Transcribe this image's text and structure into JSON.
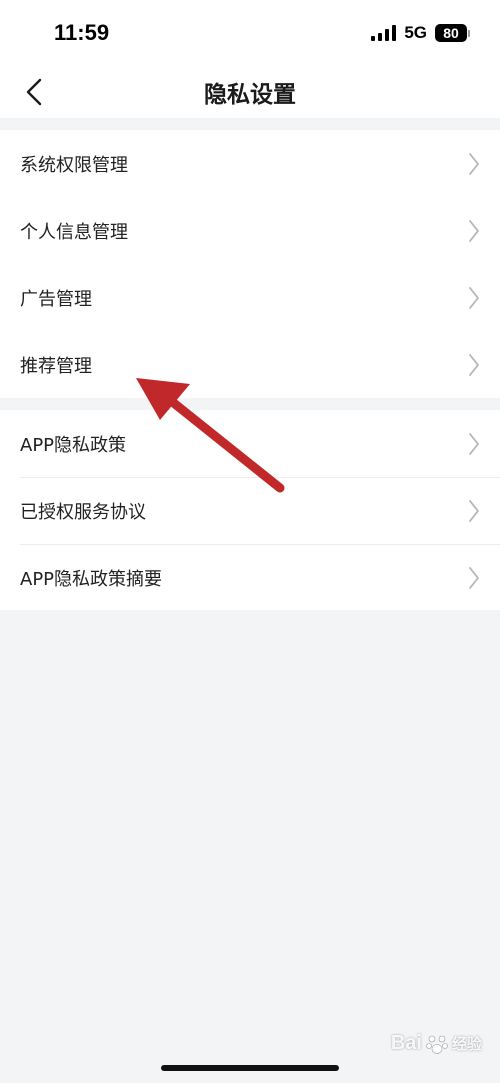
{
  "status_bar": {
    "time": "11:59",
    "network": "5G",
    "battery": "80",
    "icons": [
      "signal-icon",
      "battery-icon"
    ]
  },
  "header": {
    "title": "隐私设置",
    "back_icon": "chevron-left-icon"
  },
  "sections": [
    {
      "items": [
        {
          "label": "系统权限管理"
        },
        {
          "label": "个人信息管理"
        },
        {
          "label": "广告管理"
        },
        {
          "label": "推荐管理"
        }
      ]
    },
    {
      "items": [
        {
          "label": "APP隐私政策"
        },
        {
          "label": "已授权服务协议"
        },
        {
          "label": "APP隐私政策摘要"
        }
      ]
    }
  ],
  "annotation": {
    "arrow_color": "#c0282a",
    "target": "推荐管理"
  },
  "watermark": {
    "brand": "Bai",
    "sub": "经验"
  },
  "colors": {
    "background": "#f3f4f6",
    "card": "#ffffff",
    "text": "#222222",
    "chevron": "#b5b5b5"
  }
}
